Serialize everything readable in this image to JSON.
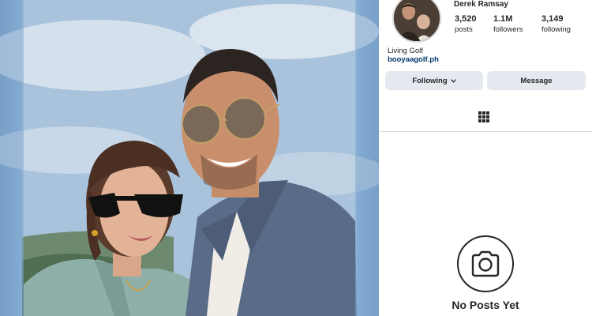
{
  "profile": {
    "username": "Derek Ramsay",
    "stats": {
      "posts": {
        "value": "3,520",
        "label": "posts"
      },
      "followers": {
        "value": "1.1M",
        "label": "followers"
      },
      "following": {
        "value": "3,149",
        "label": "following"
      }
    },
    "bio": "Living Golf",
    "link": "booyaagolf.ph"
  },
  "actions": {
    "following_label": "Following",
    "message_label": "Message"
  },
  "tabs": {
    "grid_icon": "grid-icon"
  },
  "empty_state": {
    "icon": "camera-icon",
    "title": "No Posts Yet"
  },
  "colors": {
    "button_bg": "#e4e8ef",
    "link": "#00376b",
    "text": "#262626",
    "divider": "#dbdbdb"
  }
}
